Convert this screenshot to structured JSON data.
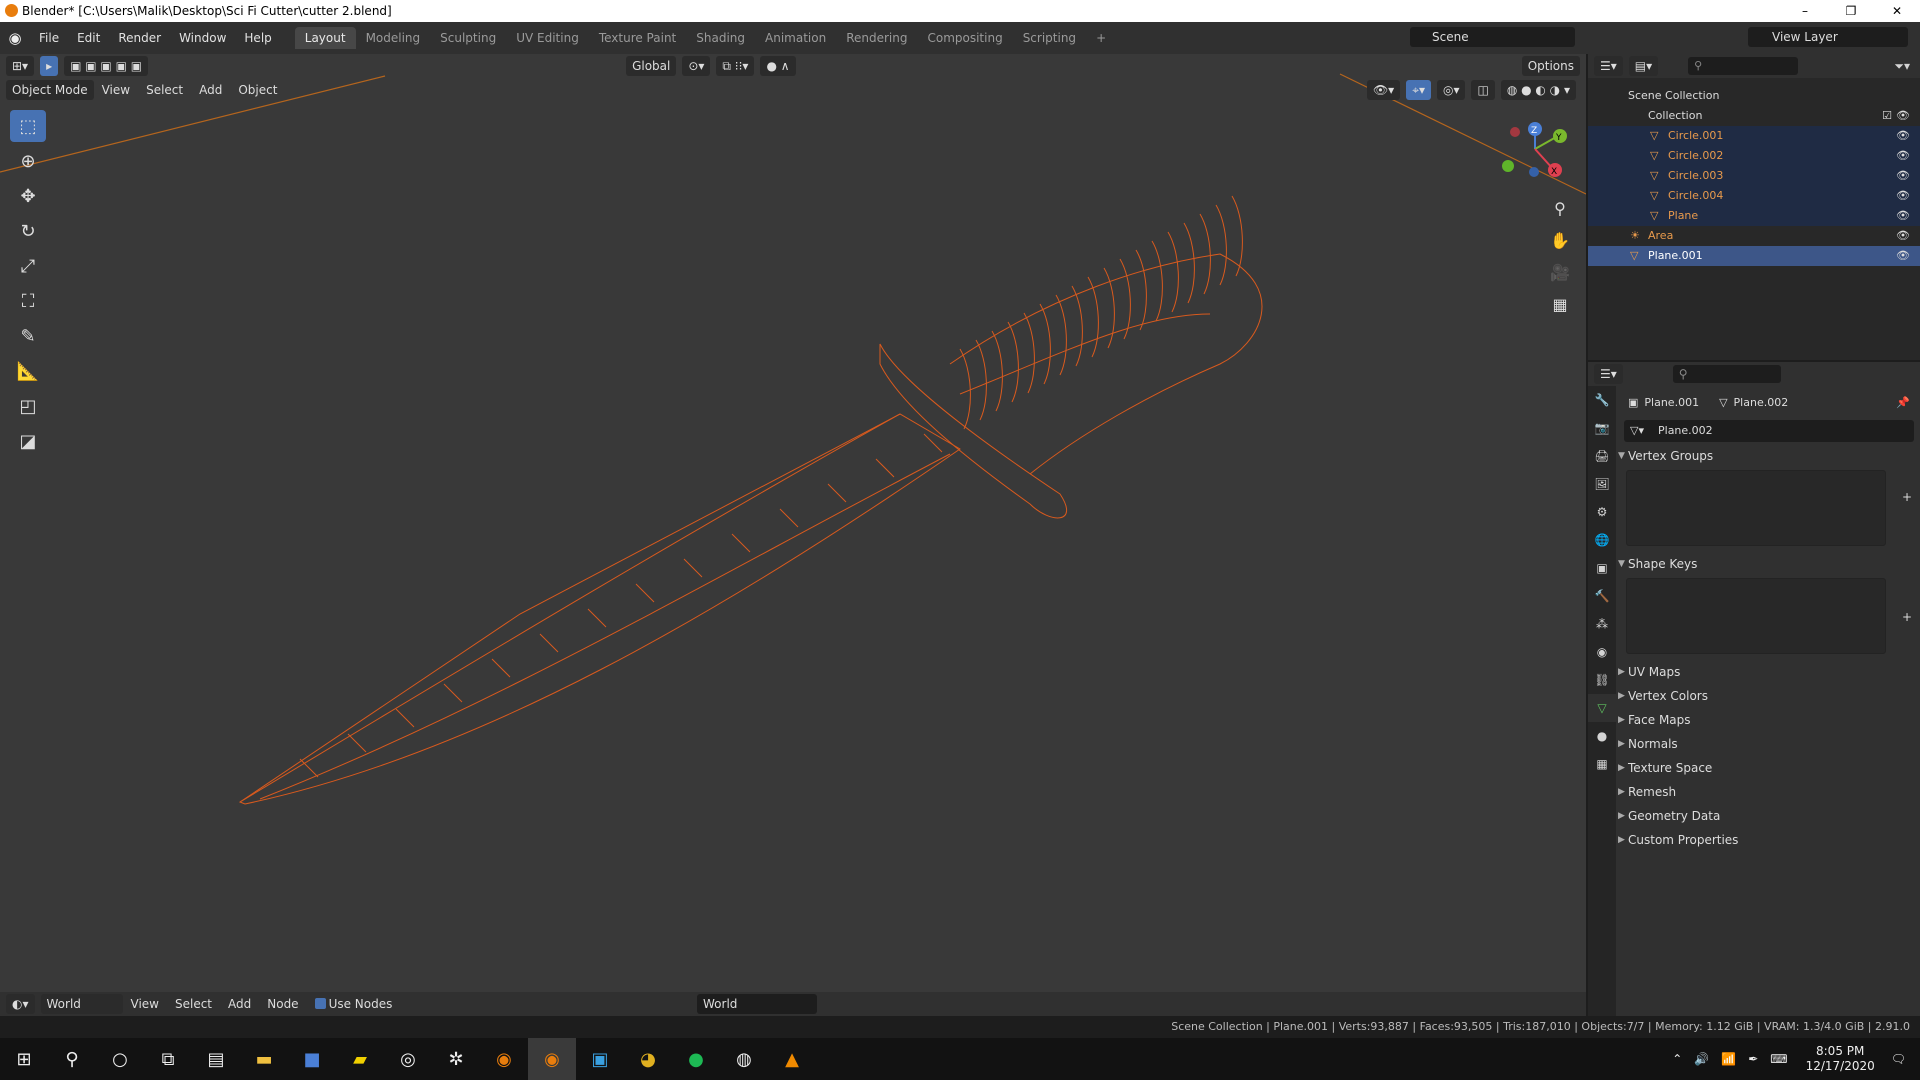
{
  "window": {
    "title": "Blender* [C:\\Users\\Malik\\Desktop\\Sci Fi Cutter\\cutter 2.blend]",
    "min": "–",
    "max": "❐",
    "close": "✕"
  },
  "menu": [
    "File",
    "Edit",
    "Render",
    "Window",
    "Help"
  ],
  "workspaces": [
    "Layout",
    "Modeling",
    "Sculpting",
    "UV Editing",
    "Texture Paint",
    "Shading",
    "Animation",
    "Rendering",
    "Compositing",
    "Scripting"
  ],
  "add_tab": "+",
  "scene": "Scene",
  "view_layer": "View Layer",
  "viewport": {
    "mode": "Object Mode",
    "menus": [
      "View",
      "Select",
      "Add",
      "Object"
    ],
    "orientation": "Global",
    "options": "Options",
    "gizmo": {
      "z": "Z",
      "y": "Y",
      "x": "X"
    },
    "wire_color": "#d85a1e",
    "bg": "#393939"
  },
  "outliner": {
    "scene_collection": "Scene Collection",
    "items": [
      {
        "name": "Collection",
        "indent": 1
      },
      {
        "name": "Circle.001",
        "indent": 2
      },
      {
        "name": "Circle.002",
        "indent": 2
      },
      {
        "name": "Circle.003",
        "indent": 2
      },
      {
        "name": "Circle.004",
        "indent": 2
      },
      {
        "name": "Plane",
        "indent": 2
      },
      {
        "name": "Area",
        "indent": 1
      },
      {
        "name": "Plane.001",
        "indent": 1
      }
    ]
  },
  "properties": {
    "object": "Plane.001",
    "mesh": "Plane.002",
    "mesh_field": "Plane.002",
    "panels_open": [
      "Vertex Groups",
      "Shape Keys"
    ],
    "panels_closed": [
      "UV Maps",
      "Vertex Colors",
      "Face Maps",
      "Normals",
      "Texture Space",
      "Remesh",
      "Geometry Data",
      "Custom Properties"
    ]
  },
  "bottom_editor": {
    "world_menu": "World",
    "menus": [
      "View",
      "Select",
      "Add",
      "Node"
    ],
    "use_nodes": "Use Nodes",
    "world_field": "World"
  },
  "status": "Scene Collection | Plane.001 | Verts:93,887 | Faces:93,505 | Tris:187,010 | Objects:7/7 | Memory: 1.12 GiB | VRAM: 1.3/4.0 GiB | 2.91.0",
  "clock": {
    "time": "8:05 PM",
    "date": "12/17/2020"
  }
}
